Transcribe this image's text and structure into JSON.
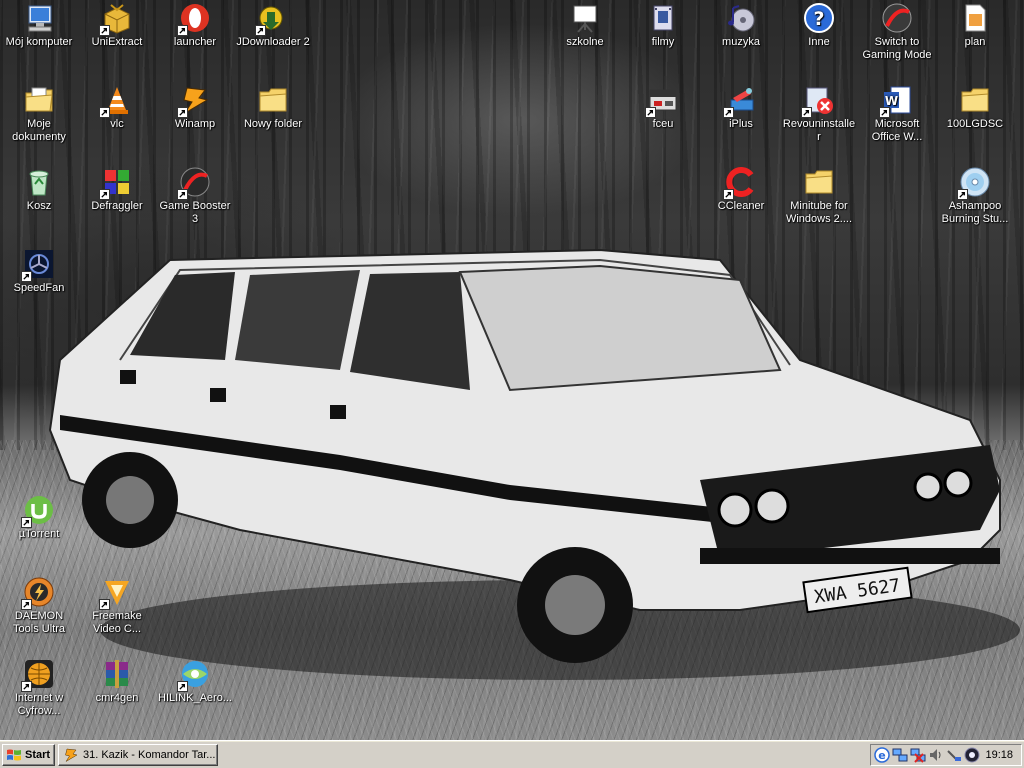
{
  "desktop_icons": [
    {
      "id": "moj-komputer",
      "label": "Mój komputer",
      "icon": "computer-icon",
      "shortcut": false
    },
    {
      "id": "uniextract",
      "label": "UniExtract",
      "icon": "box-icon",
      "shortcut": true
    },
    {
      "id": "launcher",
      "label": "launcher",
      "icon": "opera-icon",
      "shortcut": true
    },
    {
      "id": "jdownloader",
      "label": "JDownloader 2",
      "icon": "jdownloader-icon",
      "shortcut": true
    },
    {
      "id": "moje-dokumenty",
      "label": "Moje dokumenty",
      "icon": "documents-folder-icon",
      "shortcut": false
    },
    {
      "id": "vlc",
      "label": "vlc",
      "icon": "vlc-cone-icon",
      "shortcut": true
    },
    {
      "id": "winamp",
      "label": "Winamp",
      "icon": "winamp-icon",
      "shortcut": true
    },
    {
      "id": "nowy-folder",
      "label": "Nowy folder",
      "icon": "folder-icon",
      "shortcut": false
    },
    {
      "id": "kosz",
      "label": "Kosz",
      "icon": "recycle-bin-icon",
      "shortcut": false
    },
    {
      "id": "defraggler",
      "label": "Defraggler",
      "icon": "defraggler-icon",
      "shortcut": true
    },
    {
      "id": "game-booster",
      "label": "Game Booster 3",
      "icon": "game-booster-icon",
      "shortcut": true
    },
    {
      "id": "speedfan",
      "label": "SpeedFan",
      "icon": "speedfan-icon",
      "shortcut": true
    },
    {
      "id": "szkolne",
      "label": "szkolne",
      "icon": "presentation-board-icon",
      "shortcut": false
    },
    {
      "id": "filmy",
      "label": "filmy",
      "icon": "film-icon",
      "shortcut": false
    },
    {
      "id": "muzyka",
      "label": "muzyka",
      "icon": "music-icon",
      "shortcut": false
    },
    {
      "id": "inne",
      "label": "Inne",
      "icon": "help-icon",
      "shortcut": false
    },
    {
      "id": "switch-gaming",
      "label": "Switch to Gaming Mode",
      "icon": "gaming-mode-icon",
      "shortcut": false
    },
    {
      "id": "plan",
      "label": "plan",
      "icon": "document-icon",
      "shortcut": false
    },
    {
      "id": "fceu",
      "label": "fceu",
      "icon": "nes-emulator-icon",
      "shortcut": true
    },
    {
      "id": "iplus",
      "label": "iPlus",
      "icon": "iplus-icon",
      "shortcut": true
    },
    {
      "id": "revouninstaller",
      "label": "Revouninstaller",
      "icon": "uninstaller-icon",
      "shortcut": true
    },
    {
      "id": "ms-office-word",
      "label": "Microsoft Office W...",
      "icon": "word-icon",
      "shortcut": true
    },
    {
      "id": "100lgdsc",
      "label": "100LGDSC",
      "icon": "folder-icon",
      "shortcut": false
    },
    {
      "id": "ccleaner",
      "label": "CCleaner",
      "icon": "ccleaner-icon",
      "shortcut": true
    },
    {
      "id": "minitube",
      "label": "Minitube for Windows 2....",
      "icon": "folder-icon",
      "shortcut": false
    },
    {
      "id": "ashampoo",
      "label": "Ashampoo Burning Stu...",
      "icon": "disc-icon",
      "shortcut": true
    },
    {
      "id": "utorrent",
      "label": "µTorrent",
      "icon": "utorrent-icon",
      "shortcut": true
    },
    {
      "id": "daemon-tools",
      "label": "DAEMON Tools Ultra",
      "icon": "daemon-tools-icon",
      "shortcut": true
    },
    {
      "id": "freemake",
      "label": "Freemake Video C...",
      "icon": "freemake-icon",
      "shortcut": true
    },
    {
      "id": "internet-cyfrowy",
      "label": "Internet w Cyfrow...",
      "icon": "globe-icon",
      "shortcut": true
    },
    {
      "id": "cmr4gen",
      "label": "cmr4gen",
      "icon": "winrar-icon",
      "shortcut": false
    },
    {
      "id": "hilink",
      "label": "HILINK_Aero...",
      "icon": "hilink-icon",
      "shortcut": true
    }
  ],
  "wallpaper": {
    "plate_text": "XWA 5627"
  },
  "taskbar": {
    "start_label": "Start",
    "task_label": "31. Kazik - Komandor Tar...",
    "task_icon": "winamp-icon",
    "tray_icons": [
      "internet-explorer-icon",
      "network-icon",
      "network-disconnected-icon",
      "speaker-icon",
      "usb-icon",
      "daemon-tools-icon"
    ],
    "clock": "19:18"
  },
  "colors": {
    "taskbar_bg": "#d4d0c8",
    "icon_text": "#ffffff"
  }
}
